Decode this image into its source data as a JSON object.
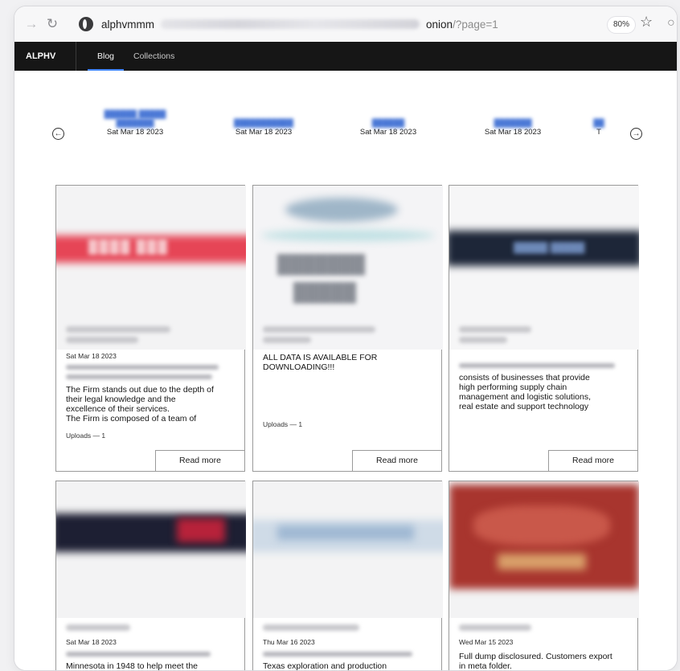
{
  "browser": {
    "url_host": "alphvmmm",
    "url_tld": "onion",
    "url_query": "/?page=1",
    "zoom": "80%"
  },
  "site": {
    "brand": "ALPHV",
    "nav": [
      "Blog",
      "Collections"
    ]
  },
  "carousel": [
    {
      "link": "",
      "date": "Sat Mar 18 2023"
    },
    {
      "link": "",
      "date": "Sat Mar 18 2023"
    },
    {
      "link": "",
      "date": "Sat Mar 18 2023"
    },
    {
      "link": "",
      "date": "Sat Mar 18 2023"
    },
    {
      "link": "",
      "date": "T"
    }
  ],
  "cards_row1": [
    {
      "date": "Sat Mar 18 2023",
      "text_lines": [
        "The Firm stands out due to the depth of",
        "their legal knowledge and the",
        "excellence of their services.",
        "The Firm is composed of a team of"
      ],
      "uploads": "Uploads — 1",
      "read_more": "Read more"
    },
    {
      "date": "",
      "text_lines": [
        "ALL DATA IS AVAILABLE FOR",
        "DOWNLOADING!!!"
      ],
      "uploads": "Uploads — 1",
      "read_more": "Read more"
    },
    {
      "date": "",
      "text_lines": [
        "consists of businesses that provide",
        "high performing supply chain",
        "management and logistic solutions,",
        "real estate and support technology"
      ],
      "uploads": "",
      "read_more": "Read more"
    }
  ],
  "cards_row2": [
    {
      "date": "Sat Mar 18 2023",
      "text_lines": [
        "Minnesota in 1948 to help meet the"
      ]
    },
    {
      "date": "Thu Mar 16 2023",
      "text_lines": [
        "Texas exploration and production"
      ]
    },
    {
      "date": "Wed Mar 15 2023",
      "text_lines": [
        "Full dump disclosured. Customers export",
        "in meta folder."
      ]
    }
  ]
}
